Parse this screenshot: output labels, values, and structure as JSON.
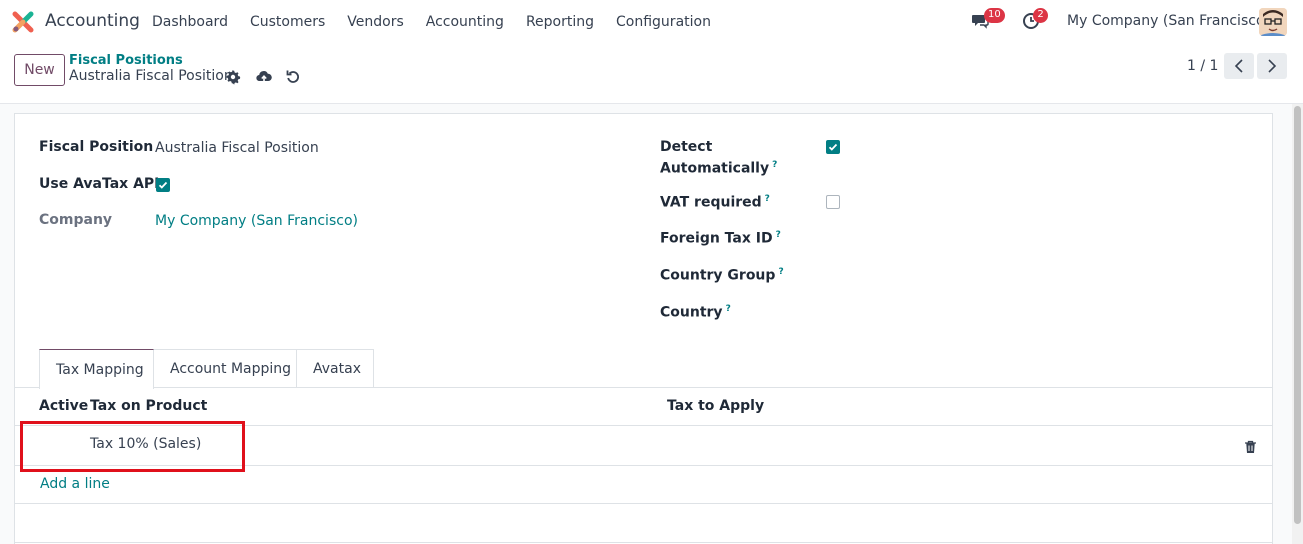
{
  "navbar": {
    "app_name": "Accounting",
    "menu": [
      "Dashboard",
      "Customers",
      "Vendors",
      "Accounting",
      "Reporting",
      "Configuration"
    ],
    "messages_count": "10",
    "activities_count": "2",
    "company": "My Company (San Francisco)"
  },
  "control": {
    "new_label": "New",
    "breadcrumb_parent": "Fiscal Positions",
    "breadcrumb_current": "Australia Fiscal Position",
    "pager": "1 / 1"
  },
  "form": {
    "fiscal_position_label": "Fiscal Position",
    "fiscal_position_value": "Australia Fiscal Position",
    "use_avatax_label": "Use AvaTax API",
    "use_avatax_checked": true,
    "company_label": "Company",
    "company_value": "My Company (San Francisco)",
    "detect_label_1": "Detect",
    "detect_label_2": "Automatically",
    "detect_checked": true,
    "vat_required_label": "VAT required",
    "vat_required_checked": false,
    "foreign_tax_id_label": "Foreign Tax ID",
    "country_group_label": "Country Group",
    "country_label": "Country",
    "help_mark": "?"
  },
  "tabs": [
    "Tax Mapping",
    "Account Mapping",
    "Avatax"
  ],
  "table": {
    "headers": {
      "active": "Active",
      "tax_on_product": "Tax on Product",
      "tax_to_apply": "Tax to Apply"
    },
    "rows": [
      {
        "tax_on_product": "Tax 10% (Sales)",
        "tax_to_apply": ""
      }
    ],
    "add_line": "Add a line"
  },
  "colors": {
    "primary": "#714b67",
    "accent": "#017e84",
    "badge": "#dc3545",
    "highlight": "#e0101b"
  }
}
